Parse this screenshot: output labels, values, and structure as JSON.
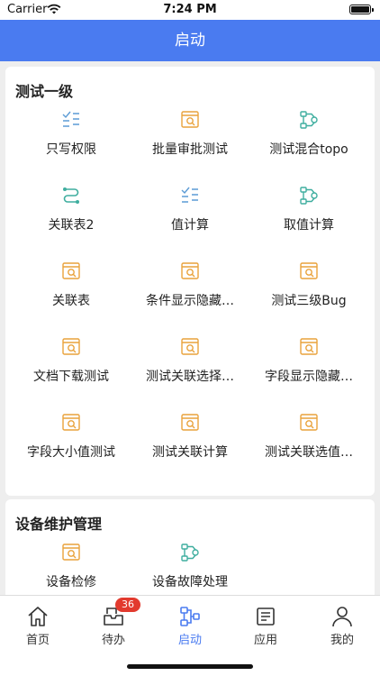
{
  "status_bar": {
    "carrier": "Carrier",
    "time": "7:24 PM"
  },
  "nav": {
    "title": "启动"
  },
  "sections": [
    {
      "title": "测试一级",
      "items": [
        {
          "label": "只写权限",
          "icon": "checklist-icon"
        },
        {
          "label": "批量审批测试",
          "icon": "form-search-icon"
        },
        {
          "label": "测试混合topo",
          "icon": "flow-icon"
        },
        {
          "label": "关联表2",
          "icon": "link-icon"
        },
        {
          "label": "值计算",
          "icon": "checklist-icon"
        },
        {
          "label": "取值计算",
          "icon": "flow-icon"
        },
        {
          "label": "关联表",
          "icon": "form-search-icon"
        },
        {
          "label": "条件显示隐藏…",
          "icon": "form-search-icon"
        },
        {
          "label": "测试三级Bug",
          "icon": "form-search-icon"
        },
        {
          "label": "文档下载测试",
          "icon": "form-search-icon"
        },
        {
          "label": "测试关联选择…",
          "icon": "form-search-icon"
        },
        {
          "label": "字段显示隐藏…",
          "icon": "form-search-icon"
        },
        {
          "label": "字段大小值测试",
          "icon": "form-search-icon"
        },
        {
          "label": "测试关联计算",
          "icon": "form-search-icon"
        },
        {
          "label": "测试关联选值…",
          "icon": "form-search-icon"
        }
      ]
    },
    {
      "title": "设备维护管理",
      "items": [
        {
          "label": "设备检修",
          "icon": "form-search-icon"
        },
        {
          "label": "设备故障处理",
          "icon": "flow-icon"
        }
      ]
    }
  ],
  "tabs": [
    {
      "label": "首页",
      "icon": "home-icon"
    },
    {
      "label": "待办",
      "icon": "todo-icon",
      "badge": "36"
    },
    {
      "label": "启动",
      "icon": "launch-icon",
      "active": true
    },
    {
      "label": "应用",
      "icon": "apps-icon"
    },
    {
      "label": "我的",
      "icon": "profile-icon"
    }
  ],
  "colors": {
    "nav": "#4a7bf0",
    "icon_orange": "#e9a23b",
    "icon_teal": "#3fae9f",
    "icon_blue": "#5b9bd5",
    "badge": "#e23a2e"
  }
}
